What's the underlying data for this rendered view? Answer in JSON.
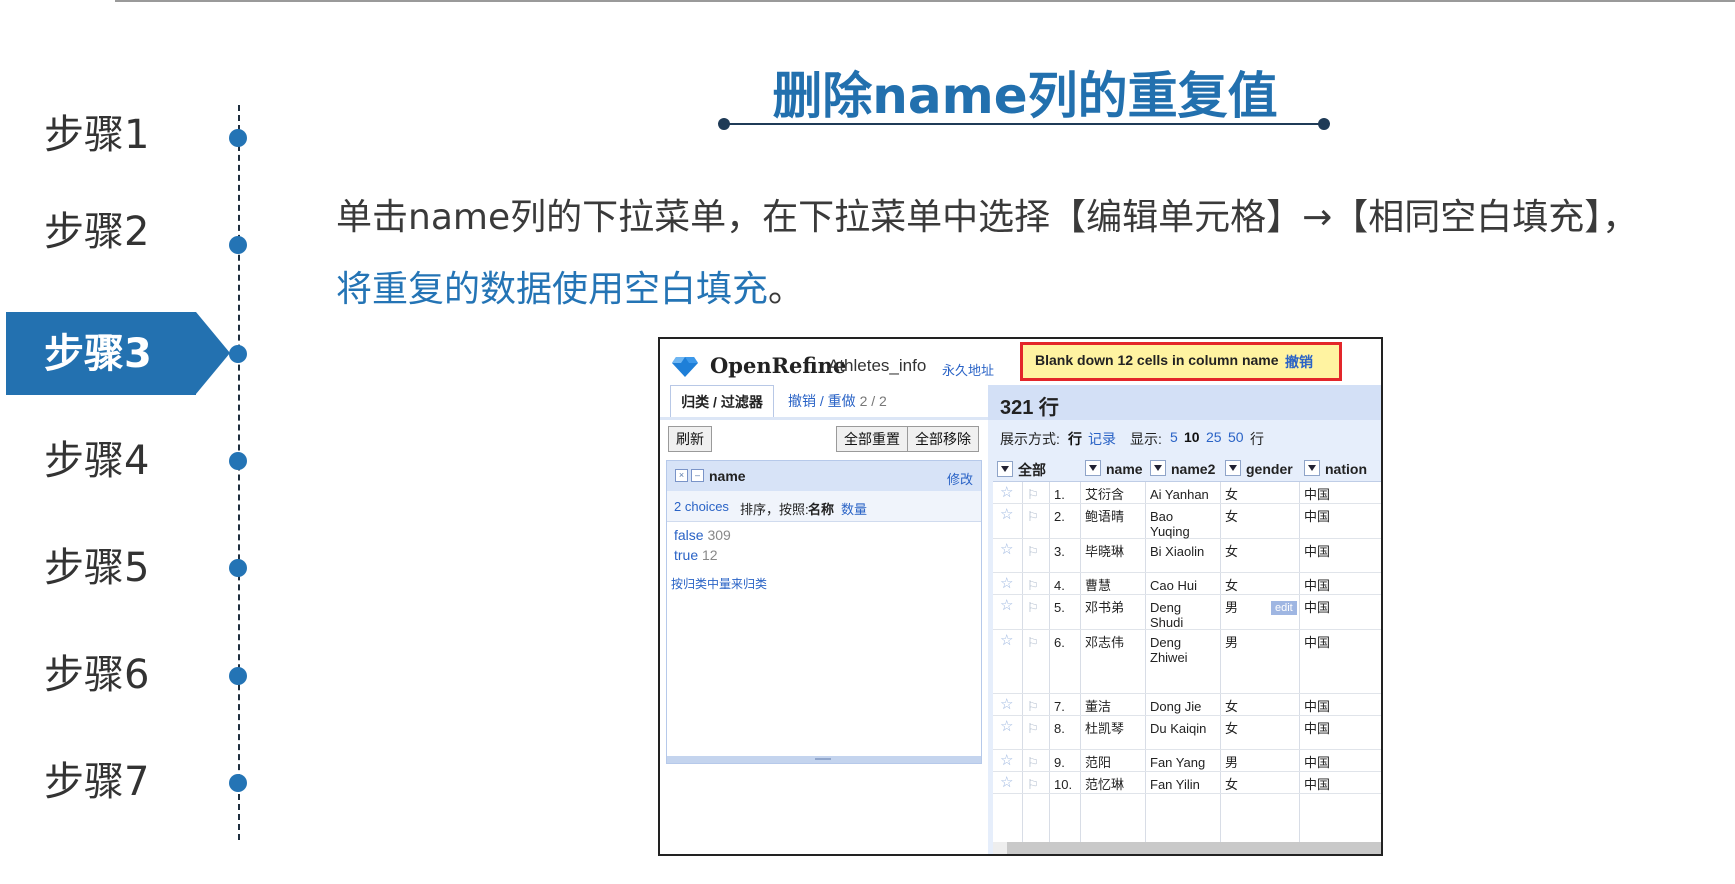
{
  "steps": [
    {
      "label": "步骤1"
    },
    {
      "label": "步骤2"
    },
    {
      "label": "步骤3"
    },
    {
      "label": "步骤4"
    },
    {
      "label": "步骤5"
    },
    {
      "label": "步骤6"
    },
    {
      "label": "步骤7"
    }
  ],
  "active_step": "步骤3",
  "slide": {
    "title": "删除name列的重复值",
    "line1": "单击name列的下拉菜单，在下拉菜单中选择【编辑单元格】→【相同空白填充】，",
    "line2": "将重复的数据使用空白填充",
    "line2_tail": "。"
  },
  "openrefine": {
    "brand": "OpenRefine",
    "project": "Athletes_info",
    "permalink": "永久地址",
    "notice": {
      "message": "Blank down 12 cells in column name",
      "undo": "撤销"
    },
    "tabs": {
      "facets": "归类 / 过滤器",
      "undo_redo": "撤销 / 重做",
      "undo_count": "2 / 2"
    },
    "buttons": {
      "refresh": "刷新",
      "reset_all": "全部重置",
      "remove_all": "全部移除"
    },
    "facet": {
      "x": "×",
      "minus": "–",
      "name": "name",
      "edit": "修改",
      "choices_label": "2 choices",
      "sort_label": "排序，按照:",
      "sort_name": "名称",
      "sort_count": "数量",
      "choices": [
        {
          "value": "false",
          "count": "309"
        },
        {
          "value": "true",
          "count": "12"
        }
      ],
      "cluster": "按归类中量来归类"
    },
    "grid": {
      "rows_count": "321 行",
      "show_as_label": "展示方式:",
      "show_rows": "行",
      "show_records": "记录",
      "show_label": "显示:",
      "page_sizes": [
        "5",
        "10",
        "25",
        "50"
      ],
      "page_unit": "行",
      "columns": [
        "全部",
        "name",
        "name2",
        "gender",
        "nation"
      ],
      "edit_label": "edit",
      "star": "☆",
      "flag": "⚐",
      "rows": [
        {
          "idx": "1.",
          "name": "艾衍含",
          "name2": [
            "Ai Yanhan"
          ],
          "gender": "女",
          "nation": "中国"
        },
        {
          "idx": "2.",
          "name": "鲍语晴",
          "name2": [
            "Bao",
            "Yuqing"
          ],
          "gender": "女",
          "nation": "中国"
        },
        {
          "idx": "3.",
          "name": "毕晓琳",
          "name2": [
            "Bi Xiaolin"
          ],
          "gender": "女",
          "nation": "中国"
        },
        {
          "idx": "4.",
          "name": "曹慧",
          "name2": [
            "Cao Hui"
          ],
          "gender": "女",
          "nation": "中国"
        },
        {
          "idx": "5.",
          "name": "邓书弟",
          "name2": [
            "Deng",
            "Shudi"
          ],
          "gender": "男",
          "nation": "中国"
        },
        {
          "idx": "6.",
          "name": "邓志伟",
          "name2": [
            "Deng",
            "Zhiwei"
          ],
          "gender": "男",
          "nation": "中国"
        },
        {
          "idx": "7.",
          "name": "董洁",
          "name2": [
            "Dong Jie"
          ],
          "gender": "女",
          "nation": "中国"
        },
        {
          "idx": "8.",
          "name": "杜凯琴",
          "name2": [
            "Du Kaiqin"
          ],
          "gender": "女",
          "nation": "中国"
        },
        {
          "idx": "9.",
          "name": "范阳",
          "name2": [
            "Fan Yang"
          ],
          "gender": "男",
          "nation": "中国"
        },
        {
          "idx": "10.",
          "name": "范忆琳",
          "name2": [
            "Fan Yilin"
          ],
          "gender": "女",
          "nation": "中国"
        }
      ]
    }
  },
  "colors": {
    "accent": "#2474b5",
    "notice_bg": "#fff3a1",
    "notice_border": "#e3262a",
    "link": "#2a63c6"
  }
}
